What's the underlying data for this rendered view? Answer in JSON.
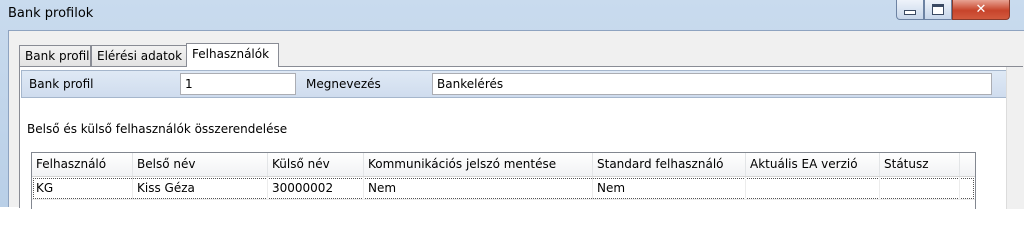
{
  "window": {
    "title": "Bank profilok",
    "close_glyph": "✕"
  },
  "tabs": [
    {
      "label": "Bank profil"
    },
    {
      "label": "Elérési adatok"
    },
    {
      "label": "Felhasználók",
      "active": true
    }
  ],
  "profile": {
    "bank_profil_label": "Bank profil",
    "bank_profil_value": "1",
    "megnevezes_label": "Megnevezés",
    "megnevezes_value": "Bankelérés"
  },
  "section_label": "Belső és külső felhasználók összerendelése",
  "grid": {
    "columns": [
      "Felhasználó",
      "Belső név",
      "Külső név",
      "Kommunikációs jelszó mentése",
      "Standard felhasználó",
      "Aktuális EA verzió",
      "Státusz"
    ],
    "rows": [
      [
        "KG",
        "Kiss Géza",
        "30000002",
        "Nem",
        "Nem",
        "",
        ""
      ]
    ]
  }
}
